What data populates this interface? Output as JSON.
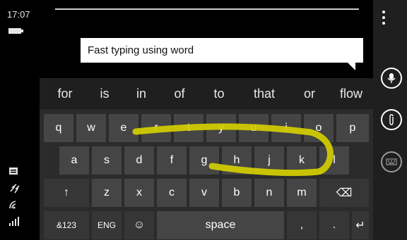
{
  "status": {
    "time": "17:07"
  },
  "message": {
    "text": "Fast typing using word"
  },
  "suggestions": [
    "for",
    "is",
    "in",
    "of",
    "to",
    "that",
    "or",
    "flow"
  ],
  "keyboard": {
    "row1": [
      "q",
      "w",
      "e",
      "r",
      "t",
      "y",
      "u",
      "i",
      "o",
      "p"
    ],
    "row2": [
      "a",
      "s",
      "d",
      "f",
      "g",
      "h",
      "j",
      "k",
      "l"
    ],
    "row3": [
      "z",
      "x",
      "c",
      "v",
      "b",
      "n",
      "m"
    ],
    "shift_glyph": "↑",
    "backspace_glyph": "⌫",
    "numbers_label": "&123",
    "lang_label": "ENG",
    "emoji_glyph": "☺",
    "space_label": "space",
    "comma_label": ",",
    "period_label": ".",
    "enter_glyph": "↵"
  },
  "colors": {
    "swipe_trail": "#d4cf00"
  },
  "appbar": {
    "icons": [
      "more-icon",
      "microphone-icon",
      "attach-icon",
      "keyboard-icon"
    ]
  }
}
